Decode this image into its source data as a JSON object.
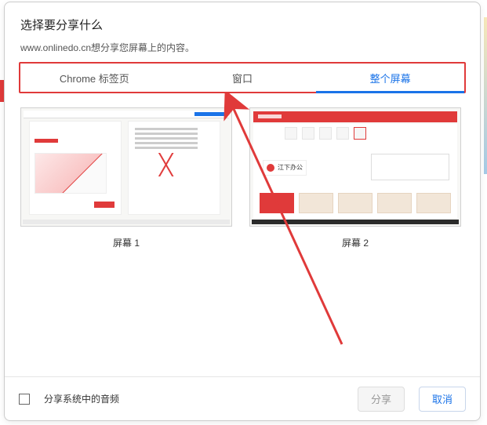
{
  "header": {
    "title": "选择要分享什么",
    "subtitle": "www.onlinedo.cn想分享您屏幕上的内容。"
  },
  "tabs": {
    "items": [
      {
        "label": "Chrome 标签页",
        "active": false
      },
      {
        "label": "窗口",
        "active": false
      },
      {
        "label": "整个屏幕",
        "active": true
      }
    ]
  },
  "screens": [
    {
      "label": "屏幕 1"
    },
    {
      "label": "屏幕 2"
    }
  ],
  "footer": {
    "audio_label": "分享系统中的音频",
    "share_label": "分享",
    "cancel_label": "取消"
  }
}
